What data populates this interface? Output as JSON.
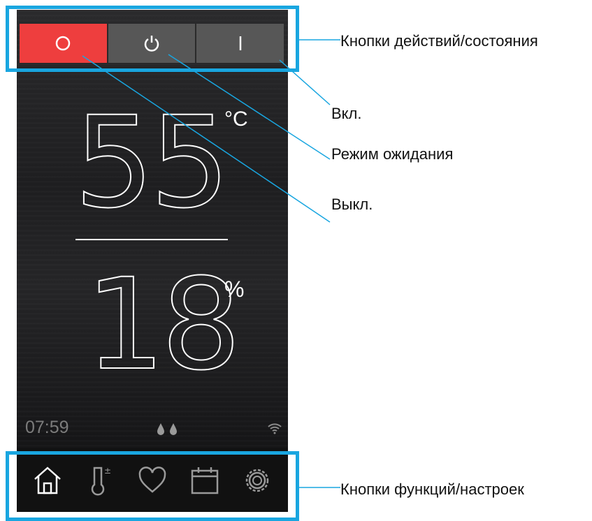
{
  "device": {
    "buttons": [
      {
        "id": "off",
        "symbol": "O"
      },
      {
        "id": "standby",
        "symbol": "⏻"
      },
      {
        "id": "on",
        "symbol": "I"
      }
    ],
    "temperature": {
      "value": "55",
      "unit": "°C"
    },
    "humidity": {
      "value": "18",
      "unit": "%"
    },
    "status": {
      "time": "07:59",
      "drops_icon": "water-drops-icon",
      "wifi_icon": "wifi-icon"
    },
    "nav": [
      {
        "icon": "home-icon"
      },
      {
        "icon": "thermometer-icon"
      },
      {
        "icon": "heart-icon"
      },
      {
        "icon": "calendar-icon"
      },
      {
        "icon": "gear-icon"
      }
    ]
  },
  "annotations": {
    "action_buttons": "Кнопки действий/состояния",
    "on": "Вкл.",
    "standby": "Режим ожидания",
    "off": "Выкл.",
    "function_buttons": "Кнопки функций/настроек"
  },
  "colors": {
    "highlight": "#19a6e0",
    "off_button": "#ee3e3e",
    "grey_button": "#575757"
  }
}
